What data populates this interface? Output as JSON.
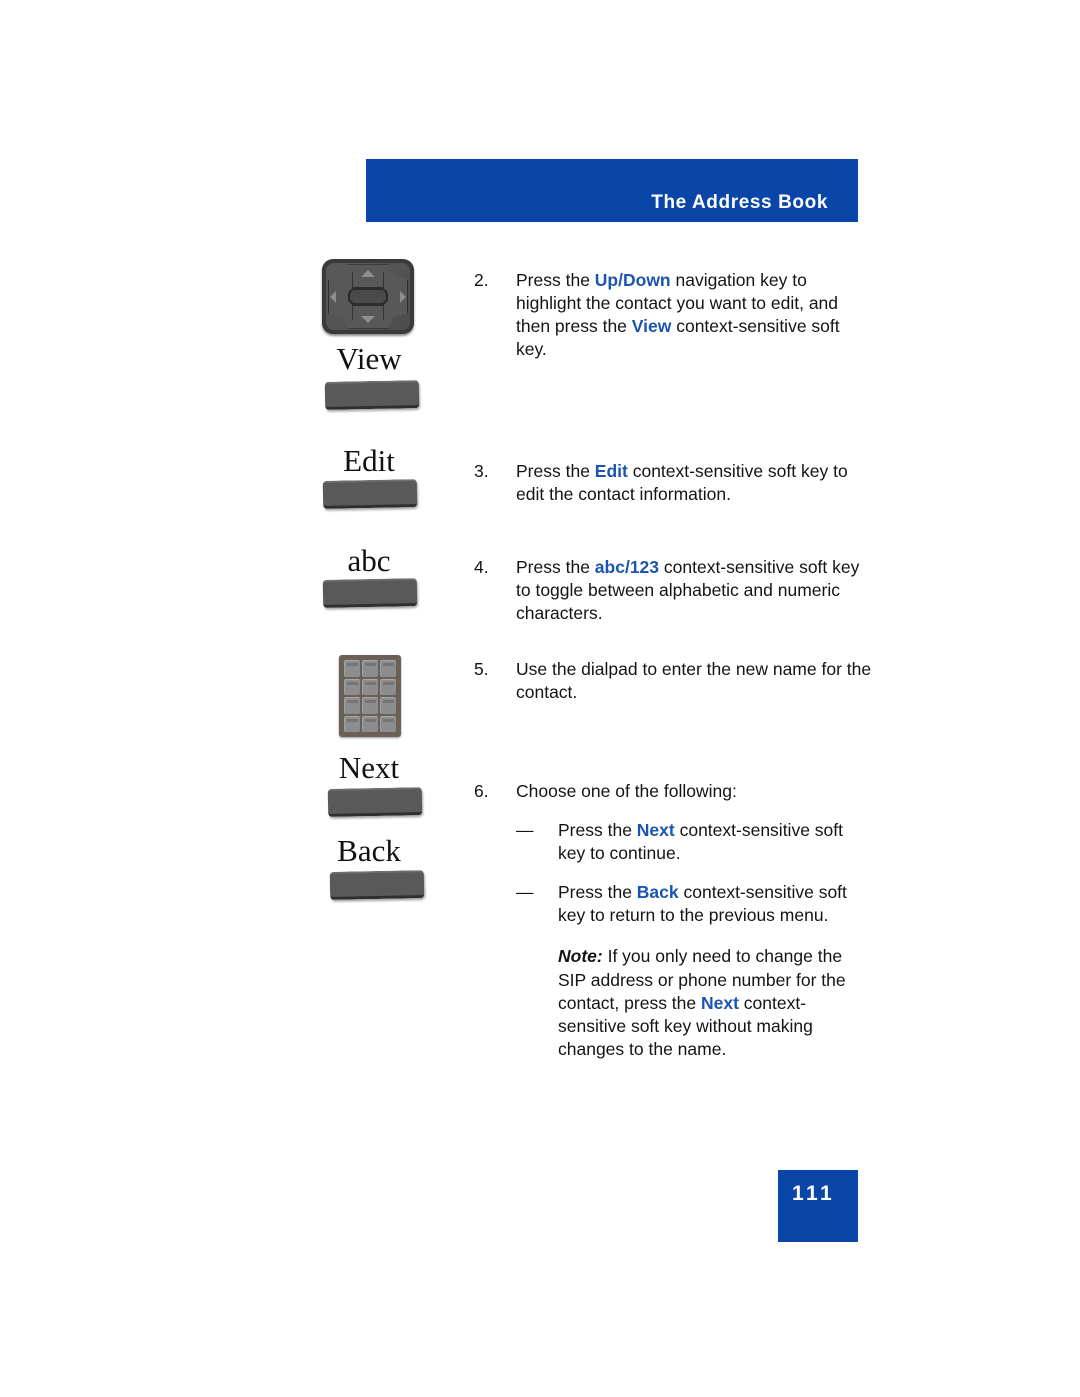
{
  "document": {
    "header_title": "The Address Book",
    "page_number": "111",
    "accent_blue": "#0a45a8",
    "keyword_blue": "#1b55b0"
  },
  "illustrations": [
    {
      "icon": "navigation-key-icon",
      "caption": "View",
      "has_softkey_button": true
    },
    {
      "icon": "soft-key-icon",
      "caption": "Edit",
      "has_softkey_button": true
    },
    {
      "icon": "soft-key-icon",
      "caption": "abc",
      "has_softkey_button": true
    },
    {
      "icon": "dialpad-icon",
      "caption": "",
      "has_softkey_button": false
    },
    {
      "icon": "soft-key-icon",
      "caption": "Next",
      "has_softkey_button": true
    },
    {
      "icon": "soft-key-icon",
      "caption": "Back",
      "has_softkey_button": true
    }
  ],
  "steps": [
    {
      "number": "2.",
      "segments": [
        {
          "text": "Press the ",
          "style": "normal"
        },
        {
          "text": "Up/Down",
          "style": "keyword"
        },
        {
          "text": " navigation key to highlight the contact you want to edit, and then press the ",
          "style": "normal"
        },
        {
          "text": "View",
          "style": "keyword"
        },
        {
          "text": " context-sensitive soft key.",
          "style": "normal"
        }
      ]
    },
    {
      "number": "3.",
      "segments": [
        {
          "text": "Press the ",
          "style": "normal"
        },
        {
          "text": "Edit",
          "style": "keyword"
        },
        {
          "text": " context-sensitive soft key to edit the contact information.",
          "style": "normal"
        }
      ]
    },
    {
      "number": "4.",
      "segments": [
        {
          "text": "Press the ",
          "style": "normal"
        },
        {
          "text": "abc/123",
          "style": "keyword"
        },
        {
          "text": " context-sensitive soft key to toggle between alphabetic and numeric characters.",
          "style": "normal"
        }
      ]
    },
    {
      "number": "5.",
      "segments": [
        {
          "text": "Use the dialpad to enter the new name for the contact.",
          "style": "normal"
        }
      ]
    },
    {
      "number": "6.",
      "segments": [
        {
          "text": "Choose one of the following:",
          "style": "normal"
        }
      ],
      "substeps": [
        {
          "dash": "—",
          "segments": [
            {
              "text": "Press the ",
              "style": "normal"
            },
            {
              "text": "Next",
              "style": "keyword"
            },
            {
              "text": " context-sensitive soft key to continue.",
              "style": "normal"
            }
          ]
        },
        {
          "dash": "—",
          "segments": [
            {
              "text": "Press the ",
              "style": "normal"
            },
            {
              "text": "Back",
              "style": "keyword"
            },
            {
              "text": " context-sensitive soft key to return to the previous menu.",
              "style": "normal"
            }
          ]
        }
      ],
      "note": {
        "label": "Note:",
        "segments": [
          {
            "text": " If you only need to change the SIP address or phone number for the contact, press the ",
            "style": "normal"
          },
          {
            "text": "Next",
            "style": "keyword"
          },
          {
            "text": " context-sensitive soft key without making changes to the name.",
            "style": "normal"
          }
        ]
      }
    }
  ]
}
